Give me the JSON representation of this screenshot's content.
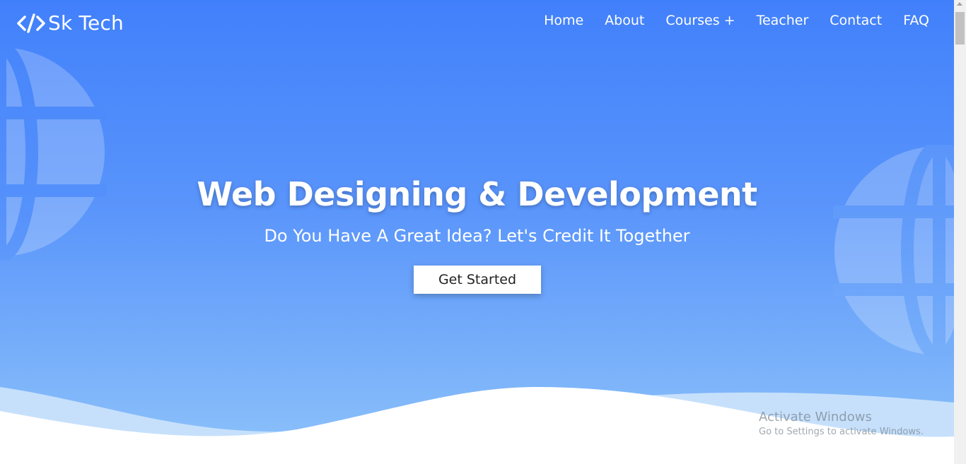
{
  "brand": {
    "name": "Sk Tech",
    "icon": "code-brackets-icon"
  },
  "nav": {
    "items": [
      {
        "label": "Home"
      },
      {
        "label": "About"
      },
      {
        "label": "Courses +"
      },
      {
        "label": "Teacher"
      },
      {
        "label": "Contact"
      },
      {
        "label": "FAQ"
      }
    ]
  },
  "hero": {
    "title": "Web Designing & Development",
    "subtitle": "Do You Have A Great Idea? Let's Credit It Together",
    "cta_label": "Get Started",
    "background_icon": "globe-icon"
  },
  "watermark": {
    "title": "Activate Windows",
    "subtitle": "Go to Settings to activate Windows."
  },
  "colors": {
    "gradient_top": "#4180fb",
    "gradient_bottom": "#8ec3fa",
    "text": "#ffffff",
    "button_bg": "#ffffff",
    "wave_light": "#c6e0fc"
  }
}
